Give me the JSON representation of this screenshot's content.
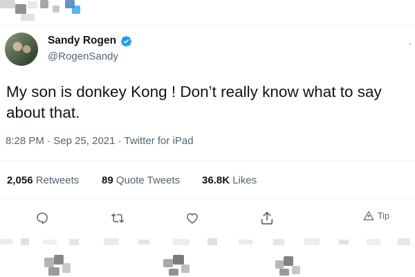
{
  "author": {
    "name": "Sandy Rogen",
    "handle": "@RogenSandy",
    "verified": true
  },
  "tweet": {
    "text_line1": "My son is donkey Kong ! Don’t really know what to say",
    "text_line2": "about that."
  },
  "meta": {
    "time": "8:28 PM",
    "date": "Sep 25, 2021",
    "source": "Twitter for iPad",
    "sep": " · "
  },
  "stats": {
    "retweets_count": "2,056",
    "retweets_label": "Retweets",
    "quotes_count": "89",
    "quotes_label": "Quote Tweets",
    "likes_count": "36.8K",
    "likes_label": "Likes"
  },
  "actions": {
    "reply_icon": "reply-icon",
    "retweet_icon": "retweet-icon",
    "like_icon": "heart-icon",
    "share_icon": "share-icon",
    "tip_label": "Tip",
    "tip_icon": "tip-icon"
  },
  "colors": {
    "text": "#0f1419",
    "muted": "#536471",
    "verified_blue": "#1d9bf0",
    "divider": "#eff3f4"
  }
}
